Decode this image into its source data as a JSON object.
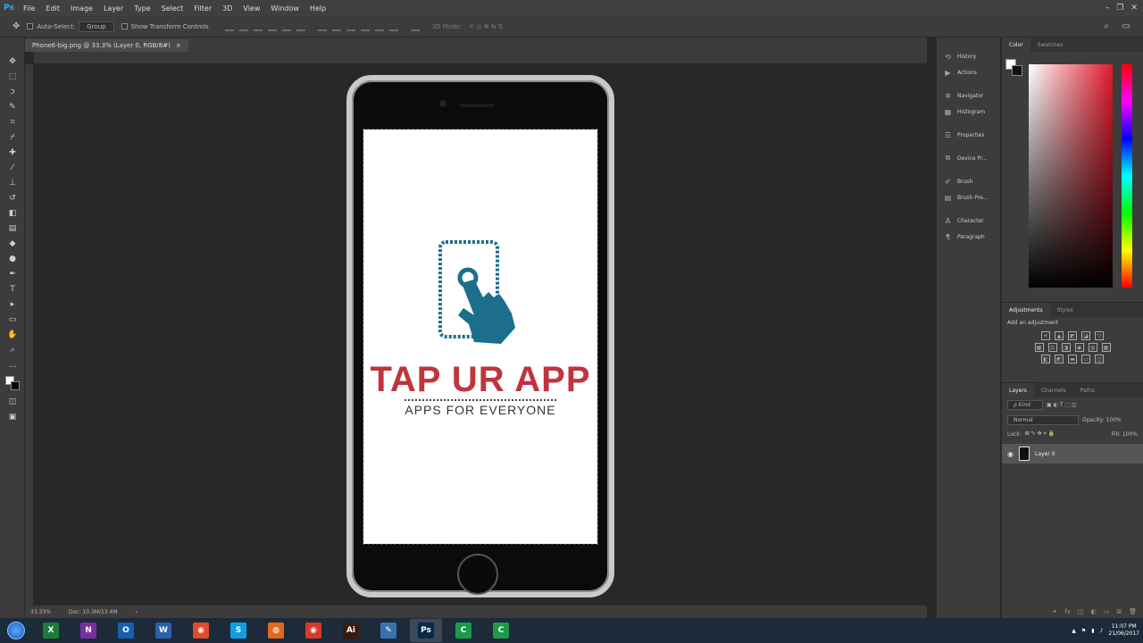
{
  "app": {
    "logo": "Ps"
  },
  "menu": [
    "File",
    "Edit",
    "Image",
    "Layer",
    "Type",
    "Select",
    "Filter",
    "3D",
    "View",
    "Window",
    "Help"
  ],
  "window_controls": [
    "–",
    "❐",
    "✕"
  ],
  "options": {
    "auto_select": "Auto-Select:",
    "auto_select_value": "Group",
    "transform_controls": "Show Transform Controls",
    "mode_3d": "3D Mode:"
  },
  "document": {
    "tab_title": "Phone6-big.png @ 33.3% (Layer 0, RGB/8#)",
    "close": "×"
  },
  "status": {
    "zoom": "33.33%",
    "doc_size": "Doc: 10.3M/13.4M",
    "arrow": "›"
  },
  "artwork": {
    "brand": "TAP UR APP",
    "tagline": "APPS FOR EVERYONE",
    "colors": {
      "brand_red": "#c0343c",
      "hand_blue": "#1c6e8c"
    }
  },
  "dock": {
    "items": [
      "History",
      "Actions",
      "Navigator",
      "Histogram",
      "Properties",
      "Device Pr...",
      "Brush",
      "Brush Pre...",
      "Character",
      "Paragraph"
    ],
    "icons": [
      "history-icon",
      "actions-icon",
      "navigator-icon",
      "histogram-icon",
      "properties-icon",
      "device-preview-icon",
      "brush-icon",
      "brush-presets-icon",
      "character-icon",
      "paragraph-icon"
    ]
  },
  "panels": {
    "color_tabs": [
      "Color",
      "Swatches"
    ],
    "adjust_tabs": [
      "Adjustments",
      "Styles"
    ],
    "adjust_label": "Add an adjustment",
    "layers_tabs": [
      "Layers",
      "Channels",
      "Paths"
    ],
    "kind": "ρ Kind",
    "blend": "Normal",
    "opacity": "Opacity: 100%",
    "lock": "Lock:",
    "fill": "Fill: 100%",
    "layer_name": "Layer 0"
  },
  "taskbar": {
    "apps": [
      {
        "label": "X",
        "color": "#1d7a3c"
      },
      {
        "label": "N",
        "color": "#7a2fa0"
      },
      {
        "label": "O",
        "color": "#1561b0"
      },
      {
        "label": "W",
        "color": "#2b5fb0"
      },
      {
        "label": "◉",
        "color": "#e04a2c"
      },
      {
        "label": "S",
        "color": "#0ea0e0"
      },
      {
        "label": "◍",
        "color": "#e06a1a"
      },
      {
        "label": "◉",
        "color": "#d8382c"
      },
      {
        "label": "Ai",
        "color": "#3a1a0a"
      },
      {
        "label": "✎",
        "color": "#3a70b0"
      },
      {
        "label": "Ps",
        "color": "#0a2a4a"
      },
      {
        "label": "C",
        "color": "#1a9a4a"
      },
      {
        "label": "C",
        "color": "#1a9a4a"
      }
    ],
    "time": "11:07 PM",
    "date": "21/06/2017"
  }
}
